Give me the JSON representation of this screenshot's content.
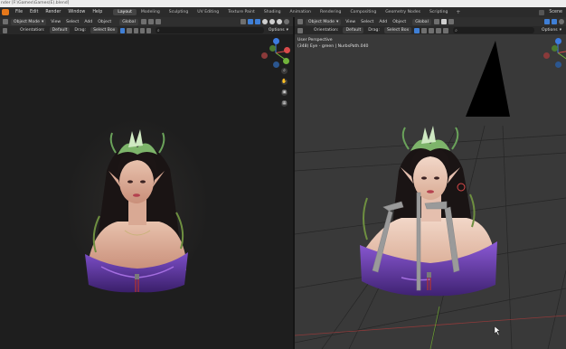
{
  "titlebar": {
    "text": "nder [F:\\Games\\Games(E).blend]"
  },
  "menubar": {
    "items": [
      "File",
      "Edit",
      "Render",
      "Window",
      "Help"
    ],
    "workspace_tabs": [
      {
        "label": "Layout",
        "active": true
      },
      {
        "label": "Modeling",
        "active": false
      },
      {
        "label": "Sculpting",
        "active": false
      },
      {
        "label": "UV Editing",
        "active": false
      },
      {
        "label": "Texture Paint",
        "active": false
      },
      {
        "label": "Shading",
        "active": false
      },
      {
        "label": "Animation",
        "active": false
      },
      {
        "label": "Rendering",
        "active": false
      },
      {
        "label": "Compositing",
        "active": false
      },
      {
        "label": "Geometry Nodes",
        "active": false
      },
      {
        "label": "Scripting",
        "active": false
      }
    ],
    "add_tab": "+",
    "scene_label": "Scene"
  },
  "left_viewport": {
    "mode": "Object Mode",
    "menus": [
      "View",
      "Select",
      "Add",
      "Object"
    ],
    "transform": "Global",
    "orientation_label": "Orientation:",
    "orientation_value": "Default",
    "drag_label": "Drag:",
    "drag_value": "Select Box",
    "options": "Options"
  },
  "right_viewport": {
    "mode": "Object Mode",
    "menus": [
      "View",
      "Select",
      "Add",
      "Object"
    ],
    "transform": "Global",
    "orientation_label": "Orientation:",
    "orientation_value": "Default",
    "drag_label": "Drag:",
    "drag_value": "Select Box",
    "options": "Options",
    "info_line1": "User Perspective",
    "info_line2": "(348) Eye - green | NurbsPath.040"
  },
  "colors": {
    "accent_blue": "#3f7fd6",
    "axis_x": "#d94a4a",
    "axis_y": "#71b33b",
    "axis_z": "#3d7be0",
    "brand_orange": "#e6781a"
  }
}
